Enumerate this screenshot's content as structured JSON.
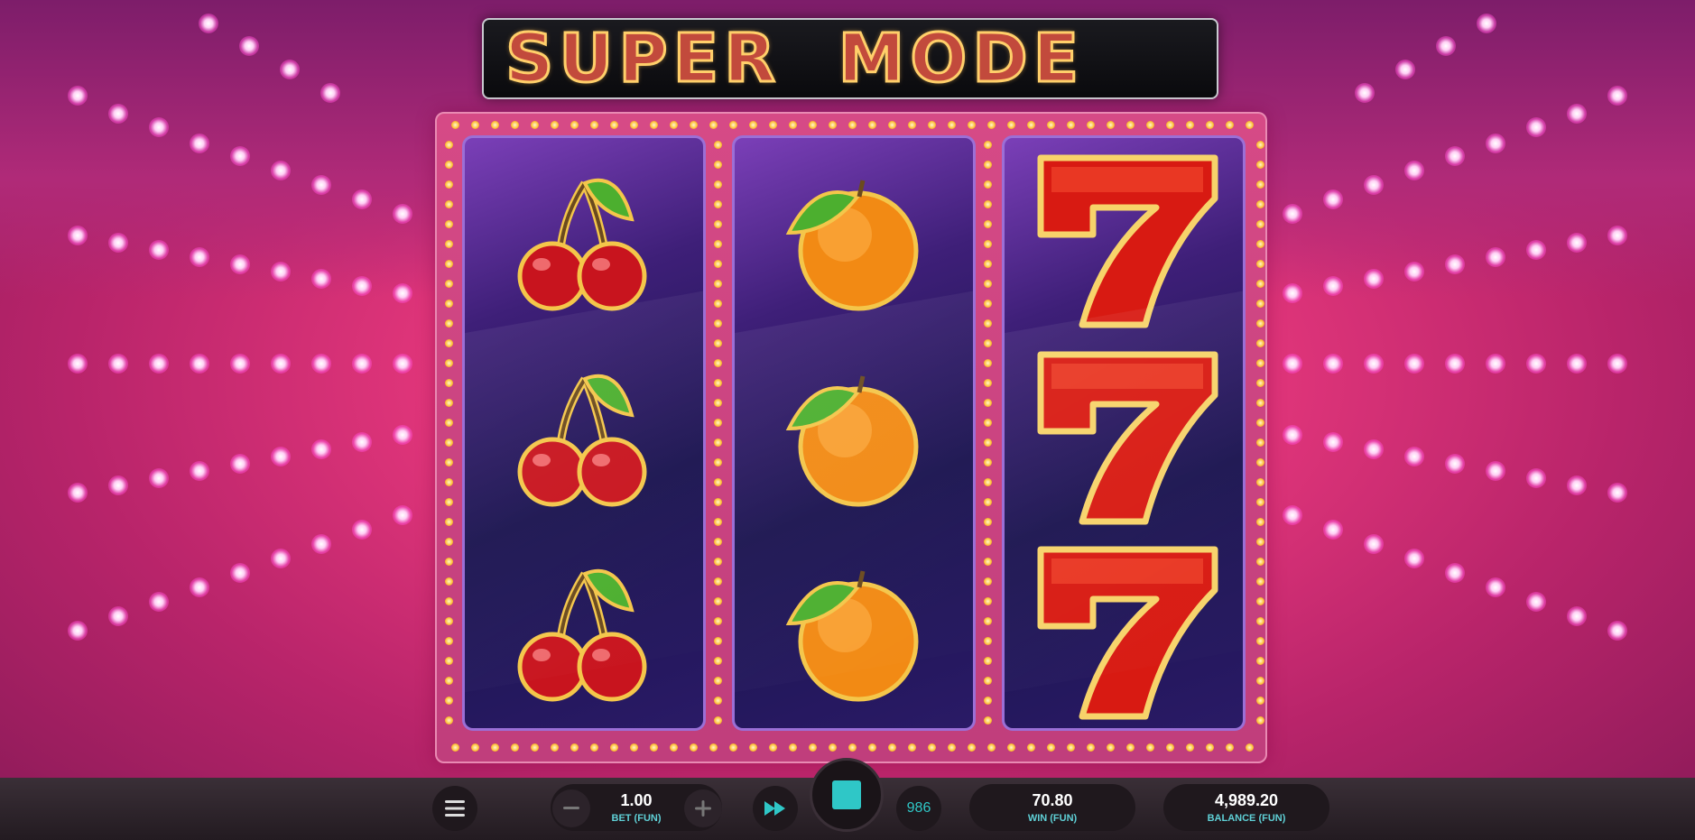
{
  "title": "SUPER  MODE",
  "reels": [
    {
      "name": "reel-1",
      "symbols": [
        "cherry",
        "cherry",
        "cherry"
      ]
    },
    {
      "name": "reel-2",
      "symbols": [
        "orange",
        "orange",
        "orange"
      ]
    },
    {
      "name": "reel-3",
      "symbols": [
        "seven",
        "seven",
        "seven"
      ]
    }
  ],
  "controls": {
    "menu_icon": "hamburger-menu-icon",
    "bet_value": "1.00",
    "bet_label": "BET (FUN)",
    "minus_icon": "minus-icon",
    "plus_icon": "plus-icon",
    "turbo_icon": "fast-forward-icon",
    "stop_icon": "stop-icon",
    "autospin_count": "986",
    "win_value": "70.80",
    "win_label": "WIN (FUN)",
    "balance_value": "4,989.20",
    "balance_label": "BALANCE (FUN)"
  },
  "colors": {
    "accent_teal": "#2fc7c7",
    "label_teal": "#5fd0d6",
    "background_pink": "#e0357a"
  }
}
